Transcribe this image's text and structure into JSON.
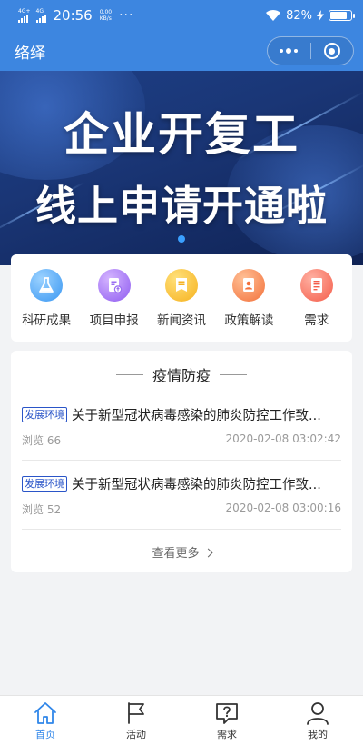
{
  "status_bar": {
    "sim1": "4G+",
    "sim2": "4G",
    "time": "20:56",
    "speed_value": "0.00",
    "speed_unit": "KB/s",
    "battery": "82%",
    "battery_level": 0.82
  },
  "nav": {
    "title": "络绎"
  },
  "banner": {
    "line1": "企业开复工",
    "line2": "线上申请开通啦"
  },
  "quick_nav": [
    {
      "label": "科研成果",
      "icon": "flask-icon"
    },
    {
      "label": "项目申报",
      "icon": "document-upload-icon"
    },
    {
      "label": "新闻资讯",
      "icon": "news-icon"
    },
    {
      "label": "政策解读",
      "icon": "policy-icon"
    },
    {
      "label": "需求",
      "icon": "requirement-icon"
    }
  ],
  "epidemic": {
    "section_title": "疫情防疫",
    "items": [
      {
        "tag": "发展环境",
        "title": "关于新型冠状病毒感染的肺炎防控工作致...",
        "views": "浏览 66",
        "date": "2020-02-08 03:02:42"
      },
      {
        "tag": "发展环境",
        "title": "关于新型冠状病毒感染的肺炎防控工作致...",
        "views": "浏览 52",
        "date": "2020-02-08 03:00:16"
      }
    ],
    "view_more": "查看更多"
  },
  "tabs": [
    {
      "label": "首页",
      "icon": "home-icon",
      "active": true
    },
    {
      "label": "活动",
      "icon": "flag-icon",
      "active": false
    },
    {
      "label": "需求",
      "icon": "question-icon",
      "active": false
    },
    {
      "label": "我的",
      "icon": "user-icon",
      "active": false
    }
  ],
  "colors": {
    "header_blue": "#3d86e0",
    "active_tab": "#2f86e9",
    "tag_blue": "#2a55c8"
  }
}
